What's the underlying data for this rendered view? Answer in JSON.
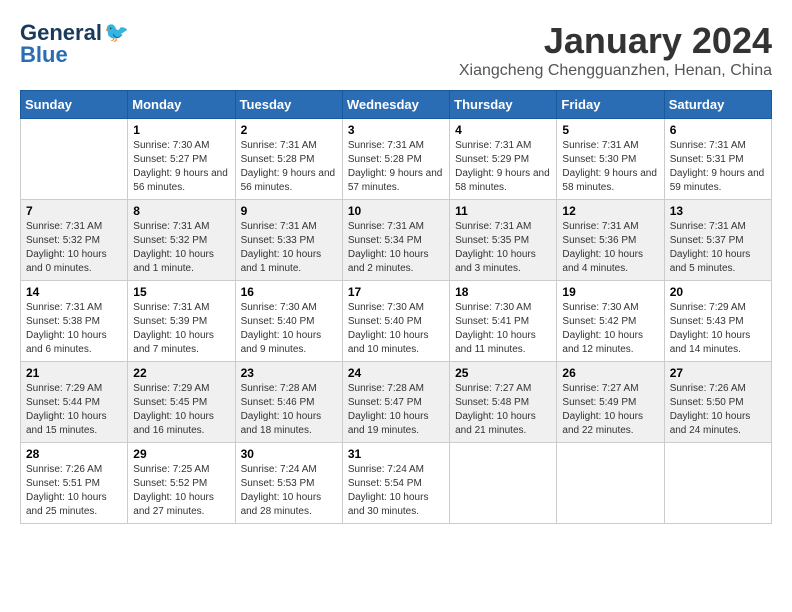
{
  "header": {
    "logo_general": "General",
    "logo_blue": "Blue",
    "month_title": "January 2024",
    "location": "Xiangcheng Chengguanzhen, Henan, China"
  },
  "days_of_week": [
    "Sunday",
    "Monday",
    "Tuesday",
    "Wednesday",
    "Thursday",
    "Friday",
    "Saturday"
  ],
  "weeks": [
    [
      {
        "day": "",
        "sunrise": "",
        "sunset": "",
        "daylight": ""
      },
      {
        "day": "1",
        "sunrise": "Sunrise: 7:30 AM",
        "sunset": "Sunset: 5:27 PM",
        "daylight": "Daylight: 9 hours and 56 minutes."
      },
      {
        "day": "2",
        "sunrise": "Sunrise: 7:31 AM",
        "sunset": "Sunset: 5:28 PM",
        "daylight": "Daylight: 9 hours and 56 minutes."
      },
      {
        "day": "3",
        "sunrise": "Sunrise: 7:31 AM",
        "sunset": "Sunset: 5:28 PM",
        "daylight": "Daylight: 9 hours and 57 minutes."
      },
      {
        "day": "4",
        "sunrise": "Sunrise: 7:31 AM",
        "sunset": "Sunset: 5:29 PM",
        "daylight": "Daylight: 9 hours and 58 minutes."
      },
      {
        "day": "5",
        "sunrise": "Sunrise: 7:31 AM",
        "sunset": "Sunset: 5:30 PM",
        "daylight": "Daylight: 9 hours and 58 minutes."
      },
      {
        "day": "6",
        "sunrise": "Sunrise: 7:31 AM",
        "sunset": "Sunset: 5:31 PM",
        "daylight": "Daylight: 9 hours and 59 minutes."
      }
    ],
    [
      {
        "day": "7",
        "sunrise": "Sunrise: 7:31 AM",
        "sunset": "Sunset: 5:32 PM",
        "daylight": "Daylight: 10 hours and 0 minutes."
      },
      {
        "day": "8",
        "sunrise": "Sunrise: 7:31 AM",
        "sunset": "Sunset: 5:32 PM",
        "daylight": "Daylight: 10 hours and 1 minute."
      },
      {
        "day": "9",
        "sunrise": "Sunrise: 7:31 AM",
        "sunset": "Sunset: 5:33 PM",
        "daylight": "Daylight: 10 hours and 1 minute."
      },
      {
        "day": "10",
        "sunrise": "Sunrise: 7:31 AM",
        "sunset": "Sunset: 5:34 PM",
        "daylight": "Daylight: 10 hours and 2 minutes."
      },
      {
        "day": "11",
        "sunrise": "Sunrise: 7:31 AM",
        "sunset": "Sunset: 5:35 PM",
        "daylight": "Daylight: 10 hours and 3 minutes."
      },
      {
        "day": "12",
        "sunrise": "Sunrise: 7:31 AM",
        "sunset": "Sunset: 5:36 PM",
        "daylight": "Daylight: 10 hours and 4 minutes."
      },
      {
        "day": "13",
        "sunrise": "Sunrise: 7:31 AM",
        "sunset": "Sunset: 5:37 PM",
        "daylight": "Daylight: 10 hours and 5 minutes."
      }
    ],
    [
      {
        "day": "14",
        "sunrise": "Sunrise: 7:31 AM",
        "sunset": "Sunset: 5:38 PM",
        "daylight": "Daylight: 10 hours and 6 minutes."
      },
      {
        "day": "15",
        "sunrise": "Sunrise: 7:31 AM",
        "sunset": "Sunset: 5:39 PM",
        "daylight": "Daylight: 10 hours and 7 minutes."
      },
      {
        "day": "16",
        "sunrise": "Sunrise: 7:30 AM",
        "sunset": "Sunset: 5:40 PM",
        "daylight": "Daylight: 10 hours and 9 minutes."
      },
      {
        "day": "17",
        "sunrise": "Sunrise: 7:30 AM",
        "sunset": "Sunset: 5:40 PM",
        "daylight": "Daylight: 10 hours and 10 minutes."
      },
      {
        "day": "18",
        "sunrise": "Sunrise: 7:30 AM",
        "sunset": "Sunset: 5:41 PM",
        "daylight": "Daylight: 10 hours and 11 minutes."
      },
      {
        "day": "19",
        "sunrise": "Sunrise: 7:30 AM",
        "sunset": "Sunset: 5:42 PM",
        "daylight": "Daylight: 10 hours and 12 minutes."
      },
      {
        "day": "20",
        "sunrise": "Sunrise: 7:29 AM",
        "sunset": "Sunset: 5:43 PM",
        "daylight": "Daylight: 10 hours and 14 minutes."
      }
    ],
    [
      {
        "day": "21",
        "sunrise": "Sunrise: 7:29 AM",
        "sunset": "Sunset: 5:44 PM",
        "daylight": "Daylight: 10 hours and 15 minutes."
      },
      {
        "day": "22",
        "sunrise": "Sunrise: 7:29 AM",
        "sunset": "Sunset: 5:45 PM",
        "daylight": "Daylight: 10 hours and 16 minutes."
      },
      {
        "day": "23",
        "sunrise": "Sunrise: 7:28 AM",
        "sunset": "Sunset: 5:46 PM",
        "daylight": "Daylight: 10 hours and 18 minutes."
      },
      {
        "day": "24",
        "sunrise": "Sunrise: 7:28 AM",
        "sunset": "Sunset: 5:47 PM",
        "daylight": "Daylight: 10 hours and 19 minutes."
      },
      {
        "day": "25",
        "sunrise": "Sunrise: 7:27 AM",
        "sunset": "Sunset: 5:48 PM",
        "daylight": "Daylight: 10 hours and 21 minutes."
      },
      {
        "day": "26",
        "sunrise": "Sunrise: 7:27 AM",
        "sunset": "Sunset: 5:49 PM",
        "daylight": "Daylight: 10 hours and 22 minutes."
      },
      {
        "day": "27",
        "sunrise": "Sunrise: 7:26 AM",
        "sunset": "Sunset: 5:50 PM",
        "daylight": "Daylight: 10 hours and 24 minutes."
      }
    ],
    [
      {
        "day": "28",
        "sunrise": "Sunrise: 7:26 AM",
        "sunset": "Sunset: 5:51 PM",
        "daylight": "Daylight: 10 hours and 25 minutes."
      },
      {
        "day": "29",
        "sunrise": "Sunrise: 7:25 AM",
        "sunset": "Sunset: 5:52 PM",
        "daylight": "Daylight: 10 hours and 27 minutes."
      },
      {
        "day": "30",
        "sunrise": "Sunrise: 7:24 AM",
        "sunset": "Sunset: 5:53 PM",
        "daylight": "Daylight: 10 hours and 28 minutes."
      },
      {
        "day": "31",
        "sunrise": "Sunrise: 7:24 AM",
        "sunset": "Sunset: 5:54 PM",
        "daylight": "Daylight: 10 hours and 30 minutes."
      },
      {
        "day": "",
        "sunrise": "",
        "sunset": "",
        "daylight": ""
      },
      {
        "day": "",
        "sunrise": "",
        "sunset": "",
        "daylight": ""
      },
      {
        "day": "",
        "sunrise": "",
        "sunset": "",
        "daylight": ""
      }
    ]
  ]
}
